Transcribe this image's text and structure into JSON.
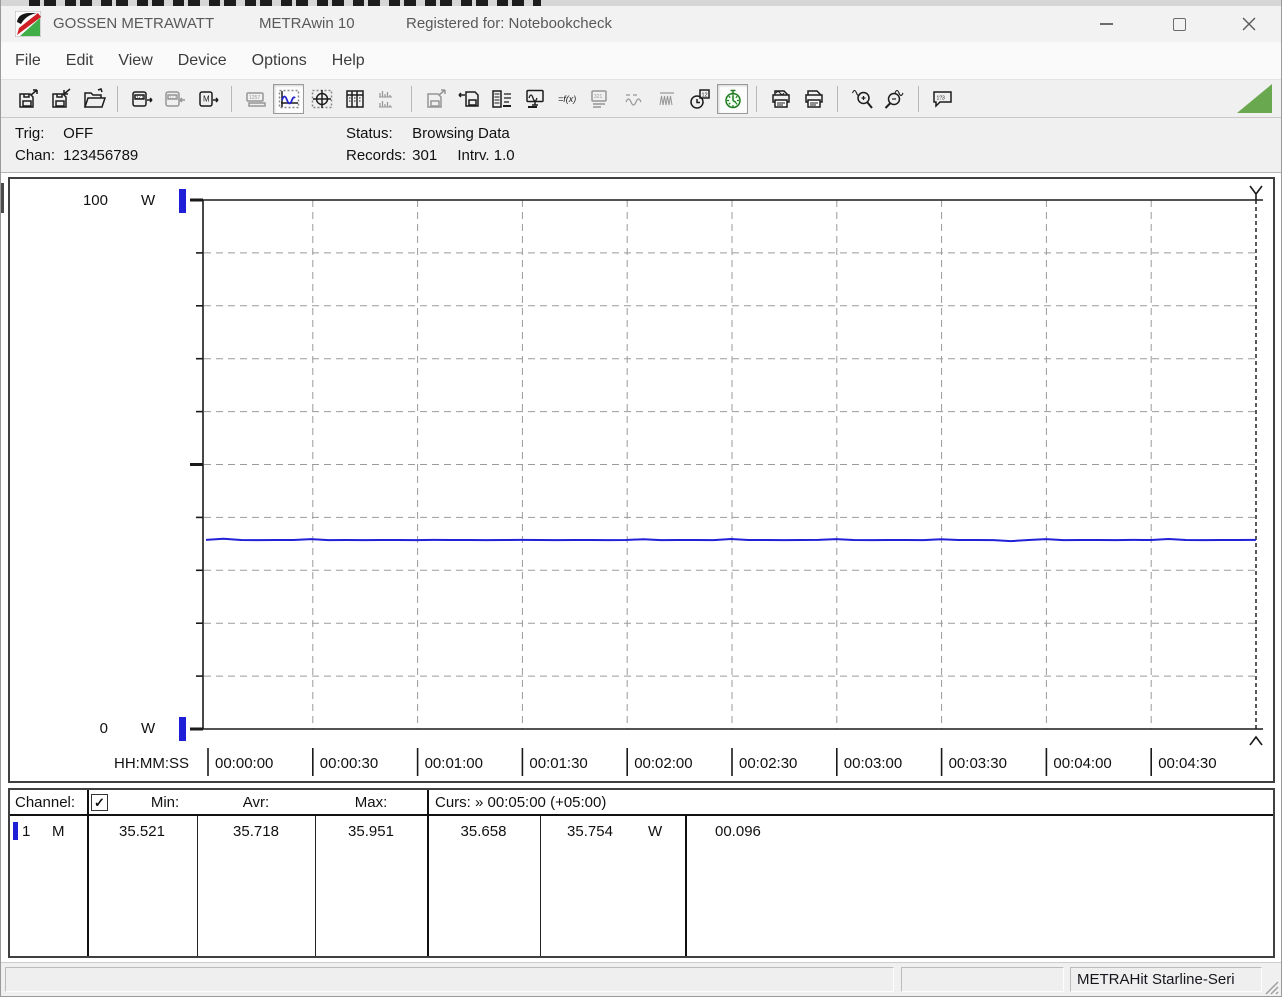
{
  "titlebar": {
    "brand": "GOSSEN METRAWATT",
    "app": "METRAwin 10",
    "registered": "Registered for: Notebookcheck",
    "window_controls": [
      "minimize",
      "maximize",
      "close"
    ]
  },
  "menu": [
    "File",
    "Edit",
    "View",
    "Device",
    "Options",
    "Help"
  ],
  "toolbar": {
    "groups": [
      [
        {
          "icon": "save-export"
        },
        {
          "icon": "save-import"
        },
        {
          "icon": "open-file"
        }
      ],
      [
        {
          "icon": "device-read"
        },
        {
          "icon": "device-write",
          "disabled": true
        },
        {
          "icon": "device-memory"
        }
      ],
      [
        {
          "icon": "meter-display",
          "disabled": true
        },
        {
          "icon": "chart-view",
          "pressed": true
        },
        {
          "icon": "cursor-view"
        },
        {
          "icon": "table-view"
        },
        {
          "icon": "histogram-view",
          "disabled": true
        }
      ],
      [
        {
          "icon": "export-data",
          "disabled": true
        },
        {
          "icon": "import-data"
        },
        {
          "icon": "value-list"
        },
        {
          "icon": "monitor-view"
        },
        {
          "icon": "formula"
        },
        {
          "icon": "device-config",
          "disabled": true
        },
        {
          "icon": "wave-single",
          "disabled": true
        },
        {
          "icon": "wave-periodic",
          "disabled": true
        },
        {
          "icon": "clock-sync"
        },
        {
          "icon": "timer",
          "pressed": true
        }
      ],
      [
        {
          "icon": "print-preview"
        },
        {
          "icon": "print"
        }
      ],
      [
        {
          "icon": "zoom-in"
        },
        {
          "icon": "zoom-out"
        }
      ],
      [
        {
          "icon": "hint"
        }
      ]
    ],
    "indicator_color": "#6aa84f"
  },
  "statusline": {
    "trig_label": "Trig:",
    "trig_value": "OFF",
    "chan_label": "Chan:",
    "chan_value": "123456789",
    "status_label": "Status:",
    "status_value": "Browsing Data",
    "records_label": "Records:",
    "records_value": "301",
    "intrv_label": "Intrv.",
    "intrv_value": "1.0"
  },
  "chart_data": {
    "type": "line",
    "title": "",
    "grid": true,
    "ylim": [
      0,
      100
    ],
    "y_axis": {
      "top": "100",
      "bottom": "0",
      "unit": "W"
    },
    "x_label": "HH:MM:SS",
    "x_ticks": [
      "00:00:00",
      "00:00:30",
      "00:01:00",
      "00:01:30",
      "00:02:00",
      "00:02:30",
      "00:03:00",
      "00:03:30",
      "00:04:00",
      "00:04:30"
    ],
    "x_interval_seconds": 30,
    "cursor": {
      "label": "00:05:00",
      "at_right_edge": true
    },
    "series": [
      {
        "name": "Channel 1",
        "unit": "W",
        "color": "#2121d8",
        "sample_interval_s": 5,
        "values": [
          35.75,
          35.95,
          35.72,
          35.71,
          35.73,
          35.72,
          35.9,
          35.71,
          35.72,
          35.7,
          35.73,
          35.72,
          35.71,
          35.74,
          35.72,
          35.73,
          35.71,
          35.72,
          35.74,
          35.72,
          35.71,
          35.73,
          35.72,
          35.7,
          35.72,
          35.88,
          35.71,
          35.73,
          35.72,
          35.71,
          35.92,
          35.72,
          35.73,
          35.71,
          35.72,
          35.74,
          35.9,
          35.72,
          35.71,
          35.73,
          35.72,
          35.71,
          35.87,
          35.72,
          35.73,
          35.71,
          35.52,
          35.72,
          35.89,
          35.71,
          35.73,
          35.72,
          35.71,
          35.74,
          35.72,
          35.91,
          35.72,
          35.71,
          35.73,
          35.72,
          35.75
        ]
      }
    ]
  },
  "readout": {
    "header": {
      "channel": "Channel:",
      "checkbox_checked": true,
      "min": "Min:",
      "avr": "Avr:",
      "max": "Max:",
      "cursor": "Curs: » 00:05:00 (+05:00)"
    },
    "row": {
      "channel_num": "1",
      "channel_mode": "M",
      "min": "35.521",
      "avr": "35.718",
      "max": "35.951",
      "cursor_a": "35.658",
      "cursor_b": "35.754",
      "unit": "W",
      "difference": "00.096",
      "marker_color": "#1f1fd8"
    }
  },
  "statusbar": {
    "device": "METRAHit Starline-Seri"
  }
}
